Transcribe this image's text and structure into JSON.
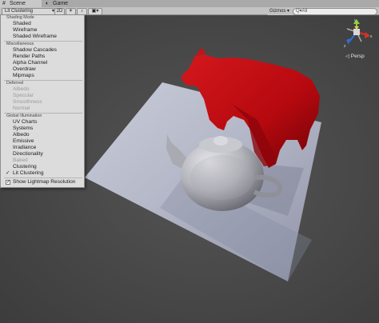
{
  "tabs": [
    {
      "label": "Scene",
      "icon": "scene-icon"
    },
    {
      "label": "Game",
      "icon": "game-icon"
    }
  ],
  "toolbar": {
    "draw_mode": "Lit Clustering",
    "mode_2d": "2D",
    "gizmos": "Gizmos",
    "search_prefix": "Q▾All"
  },
  "menu": {
    "sections": [
      {
        "header": "Shading Mode",
        "items": [
          {
            "label": "Shaded",
            "enabled": true
          },
          {
            "label": "Wireframe",
            "enabled": true
          },
          {
            "label": "Shaded Wireframe",
            "enabled": true
          }
        ]
      },
      {
        "header": "Miscellaneous",
        "items": [
          {
            "label": "Shadow Cascades",
            "enabled": true
          },
          {
            "label": "Render Paths",
            "enabled": true
          },
          {
            "label": "Alpha Channel",
            "enabled": true
          },
          {
            "label": "Overdraw",
            "enabled": true
          },
          {
            "label": "Mipmaps",
            "enabled": true
          }
        ]
      },
      {
        "header": "Deferred",
        "items": [
          {
            "label": "Albedo",
            "enabled": false
          },
          {
            "label": "Specular",
            "enabled": false
          },
          {
            "label": "Smoothness",
            "enabled": false
          },
          {
            "label": "Normal",
            "enabled": false
          }
        ]
      },
      {
        "header": "Global Illumination",
        "items": [
          {
            "label": "UV Charts",
            "enabled": true
          },
          {
            "label": "Systems",
            "enabled": true
          },
          {
            "label": "Albedo",
            "enabled": true
          },
          {
            "label": "Emissive",
            "enabled": true
          },
          {
            "label": "Irradiance",
            "enabled": true
          },
          {
            "label": "Directionality",
            "enabled": true
          },
          {
            "label": "Baked",
            "enabled": false
          },
          {
            "label": "Clustering",
            "enabled": true
          },
          {
            "label": "Lit Clustering",
            "enabled": true,
            "selected": true
          }
        ]
      }
    ],
    "show_lightmap": {
      "label": "Show Lightmap Resolution",
      "checked": true
    }
  },
  "gizmo": {
    "projection_label": "◁ Persp",
    "x_label": "x",
    "y_label": "y",
    "z_label": "z"
  }
}
